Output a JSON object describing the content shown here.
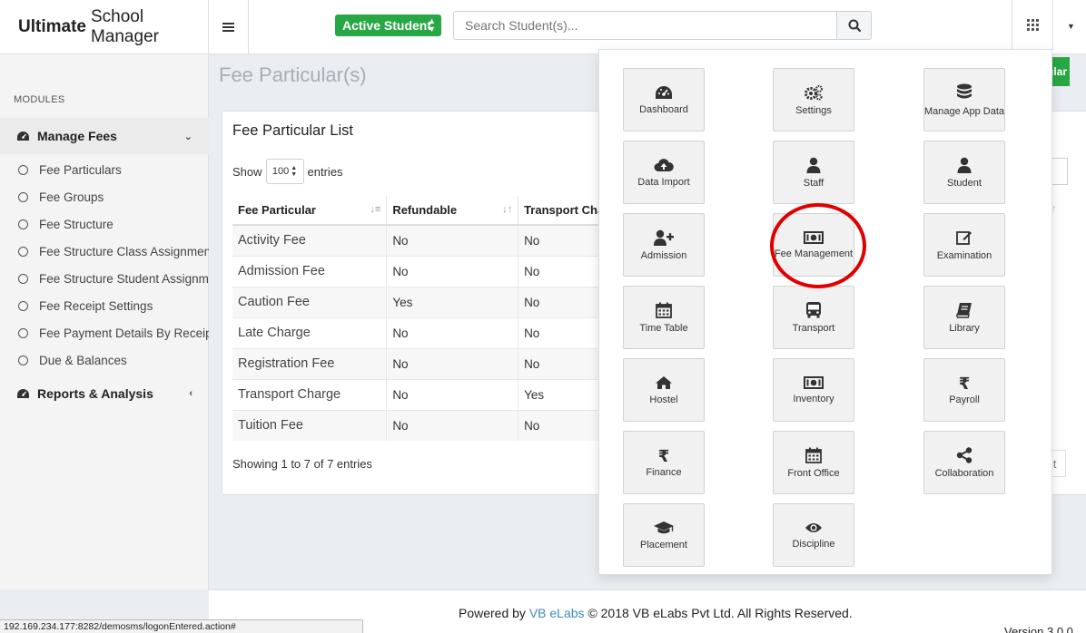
{
  "header": {
    "logo_bold": "Ultimate",
    "logo_rest": "School Manager",
    "status_select": "Active Student",
    "search_placeholder": "Search Student(s)..."
  },
  "sidebar": {
    "section_label": "MODULES",
    "groups": [
      {
        "label": "Manage Fees",
        "icon": "dashboard-gauge-icon",
        "expanded": true
      },
      {
        "label": "Reports & Analysis",
        "icon": "dashboard-gauge-icon",
        "expanded": false
      }
    ],
    "sub_items": [
      "Fee Particulars",
      "Fee Groups",
      "Fee Structure",
      "Fee Structure Class Assignment",
      "Fee Structure Student Assignment",
      "Fee Receipt Settings",
      "Fee Payment Details By Receipt No",
      "Due & Balances"
    ]
  },
  "main": {
    "page_title": "Fee Particular(s)",
    "add_button_partial": "ular",
    "panel_title": "Fee Particular List",
    "show_label": "Show",
    "show_value": "100",
    "entries_label": "entries",
    "columns": [
      "Fee Particular",
      "Refundable",
      "Transport Cha"
    ],
    "rows": [
      [
        "Activity Fee",
        "No",
        "No"
      ],
      [
        "Admission Fee",
        "No",
        "No"
      ],
      [
        "Caution Fee",
        "Yes",
        "No"
      ],
      [
        "Late Charge",
        "No",
        "No"
      ],
      [
        "Registration Fee",
        "No",
        "No"
      ],
      [
        "Transport Charge",
        "No",
        "Yes"
      ],
      [
        "Tuition Fee",
        "No",
        "No"
      ]
    ],
    "showing_text": "Showing 1 to 7 of 7 entries",
    "next_partial": "t"
  },
  "apps_menu": {
    "tiles": [
      {
        "label": "Dashboard",
        "icon": "dashboard-icon"
      },
      {
        "label": "Settings",
        "icon": "cogs-icon"
      },
      {
        "label": "Manage App Data",
        "icon": "database-icon"
      },
      {
        "label": "Data Import",
        "icon": "cloud-upload-icon"
      },
      {
        "label": "Staff",
        "icon": "user-icon"
      },
      {
        "label": "Student",
        "icon": "user-icon"
      },
      {
        "label": "Admission",
        "icon": "user-plus-icon"
      },
      {
        "label": "Fee Management",
        "icon": "money-icon"
      },
      {
        "label": "Examination",
        "icon": "edit-icon"
      },
      {
        "label": "Time Table",
        "icon": "calendar-icon"
      },
      {
        "label": "Transport",
        "icon": "bus-icon"
      },
      {
        "label": "Library",
        "icon": "book-icon"
      },
      {
        "label": "Hostel",
        "icon": "home-icon"
      },
      {
        "label": "Inventory",
        "icon": "money-icon"
      },
      {
        "label": "Payroll",
        "icon": "rupee-icon"
      },
      {
        "label": "Finance",
        "icon": "rupee-icon"
      },
      {
        "label": "Front Office",
        "icon": "calendar-icon"
      },
      {
        "label": "Collaboration",
        "icon": "share-icon"
      },
      {
        "label": "Placement",
        "icon": "graduation-cap-icon"
      },
      {
        "label": "Discipline",
        "icon": "eye-icon"
      }
    ]
  },
  "footer": {
    "powered_by": "Powered by",
    "company_link": "VB eLabs",
    "copyright": "© 2018 VB eLabs Pvt Ltd. All Rights Reserved.",
    "version": "Version 3.0.0"
  },
  "status_bar_url": "192.169.234.177:8282/demosms/logonEntered.action#",
  "colors": {
    "accent_green": "#28a745",
    "link_blue": "#3c8dbc",
    "highlight_red": "#e10000"
  }
}
